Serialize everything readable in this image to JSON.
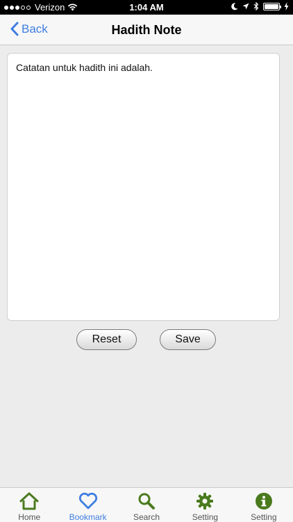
{
  "status_bar": {
    "carrier": "Verizon",
    "time": "1:04 AM"
  },
  "nav": {
    "back_label": "Back",
    "title": "Hadith Note"
  },
  "note": {
    "text": "Catatan untuk hadith ini adalah."
  },
  "buttons": {
    "reset": "Reset",
    "save": "Save"
  },
  "tabs": [
    {
      "label": "Home",
      "icon": "home-icon",
      "active": false
    },
    {
      "label": "Bookmark",
      "icon": "heart-icon",
      "active": true
    },
    {
      "label": "Search",
      "icon": "search-icon",
      "active": false
    },
    {
      "label": "Setting",
      "icon": "gear-icon",
      "active": false
    },
    {
      "label": "Setting",
      "icon": "info-icon",
      "active": false
    }
  ],
  "colors": {
    "accent": "#3f7de0",
    "tab_icon_green": "#4a7a1e"
  }
}
